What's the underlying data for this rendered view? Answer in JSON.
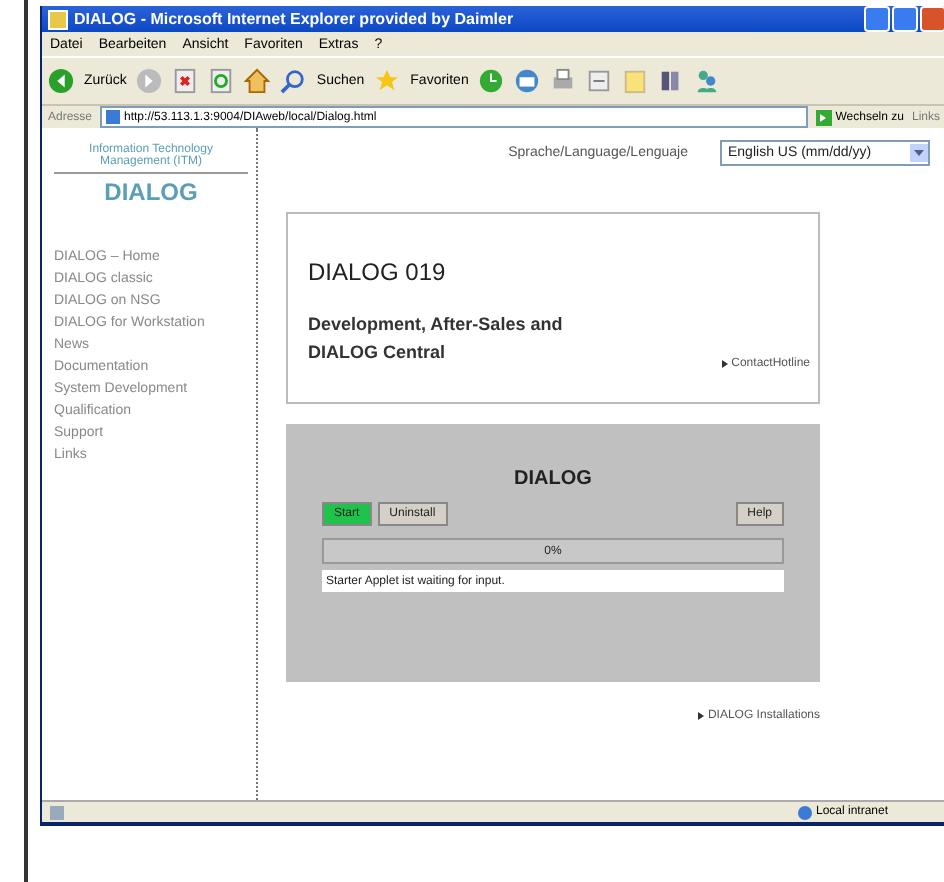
{
  "window": {
    "title": "DIALOG - Microsoft Internet Explorer provided by Daimler"
  },
  "menu": [
    "Datei",
    "Bearbeiten",
    "Ansicht",
    "Favoriten",
    "Extras",
    "?"
  ],
  "toolbar": {
    "back": "Zurück",
    "search": "Suchen",
    "favorites": "Favoriten"
  },
  "address_bar": {
    "label": "Adresse",
    "url": "http://53.113.1.3:9004/DIAweb/local/Dialog.html",
    "go": "Wechseln zu",
    "links": "Links"
  },
  "sidebar": {
    "org": "Information Technology Management (ITM)",
    "title": "DIALOG",
    "items": [
      {
        "label": "DIALOG – Home"
      },
      {
        "label": "DIALOG classic"
      },
      {
        "label": "DIALOG on NSG"
      },
      {
        "label": "DIALOG for Workstation"
      },
      {
        "label": "News"
      },
      {
        "label": "Documentation"
      },
      {
        "label": "System Development"
      },
      {
        "label": "Qualification"
      },
      {
        "label": "Support"
      },
      {
        "label": "Links"
      }
    ]
  },
  "language": {
    "label": "Sprache/Language/Lenguaje",
    "value": "English US (mm/dd/yy)"
  },
  "card": {
    "title": "DIALOG 019",
    "subtitle": "Development, After-Sales and DIALOG Central",
    "link": "ContactHotline"
  },
  "applet": {
    "title": "DIALOG",
    "buttons": [
      {
        "label": "Start",
        "kind": "primary"
      },
      {
        "label": "Uninstall",
        "kind": "normal"
      },
      {
        "label": "Help",
        "kind": "right"
      }
    ],
    "progress": {
      "level": 0,
      "text": "0%"
    },
    "message": "Starter Applet ist waiting for input."
  },
  "footer_link": "DIALOG Installations",
  "status_bar": {
    "zone": "Local intranet"
  }
}
